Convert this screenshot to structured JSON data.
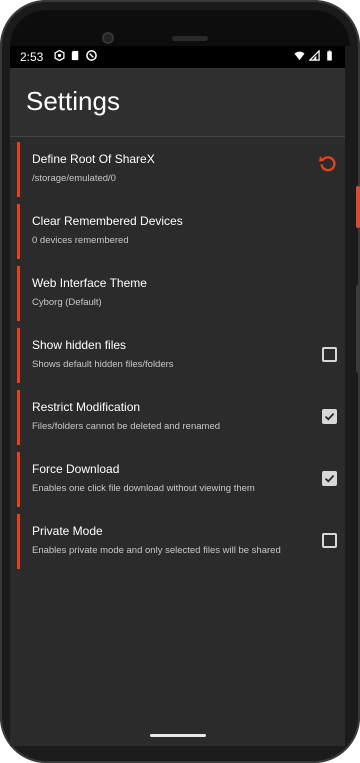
{
  "status": {
    "time": "2:53",
    "left_icons": [
      "settings-icon",
      "sd-card-icon",
      "sync-icon"
    ],
    "right_icons": [
      "wifi-icon",
      "signal-icon",
      "battery-icon"
    ]
  },
  "appbar": {
    "title": "Settings"
  },
  "settings": {
    "items": [
      {
        "title": "Define Root Of ShareX",
        "subtitle": "/storage/emulated/0",
        "control": "reset",
        "checked": false
      },
      {
        "title": "Clear Remembered Devices",
        "subtitle": "0 devices remembered",
        "control": "none",
        "checked": false
      },
      {
        "title": "Web Interface Theme",
        "subtitle": "Cyborg (Default)",
        "control": "none",
        "checked": false
      },
      {
        "title": "Show hidden files",
        "subtitle": "Shows default hidden files/folders",
        "control": "checkbox",
        "checked": false
      },
      {
        "title": "Restrict Modification",
        "subtitle": "Files/folders cannot be deleted and renamed",
        "control": "checkbox",
        "checked": true
      },
      {
        "title": "Force Download",
        "subtitle": "Enables one click file download without viewing them",
        "control": "checkbox",
        "checked": true
      },
      {
        "title": "Private Mode",
        "subtitle": "Enables private mode and only selected files will be shared",
        "control": "checkbox",
        "checked": false
      }
    ]
  },
  "colors": {
    "accent": "#e5411b",
    "background": "#2b2b2b",
    "appbar": "#2f2f2f",
    "text_primary": "#ffffff",
    "text_secondary": "#c8c8c8"
  }
}
